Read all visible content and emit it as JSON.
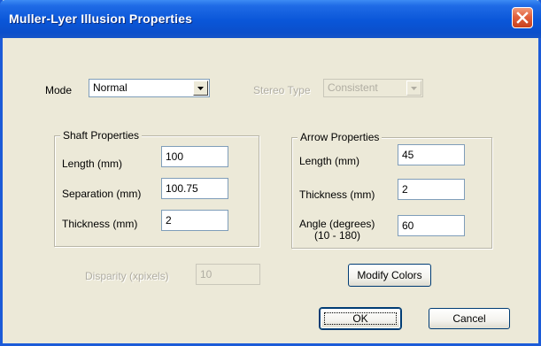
{
  "window": {
    "title": "Muller-Lyer Illusion Properties",
    "accent": "#0a56d8"
  },
  "mode": {
    "label": "Mode",
    "value": "Normal"
  },
  "stereo": {
    "label": "Stereo Type",
    "value": "Consistent",
    "enabled": false
  },
  "shaft": {
    "title": "Shaft Properties",
    "length_label": "Length (mm)",
    "length_value": "100",
    "separation_label": "Separation (mm)",
    "separation_value": "100.75",
    "thickness_label": "Thickness (mm)",
    "thickness_value": "2"
  },
  "arrow": {
    "title": "Arrow Properties",
    "length_label": "Length (mm)",
    "length_value": "45",
    "thickness_label": "Thickness (mm)",
    "thickness_value": "2",
    "angle_label_1": "Angle (degrees)",
    "angle_label_2": "(10 - 180)",
    "angle_value": "60"
  },
  "disparity": {
    "label": "Disparity (xpixels)",
    "value": "10",
    "enabled": false
  },
  "buttons": {
    "modify_colors": "Modify Colors",
    "ok": "OK",
    "cancel": "Cancel"
  },
  "icons": {
    "close": "close-icon",
    "dropdown": "chevron-down-icon"
  }
}
